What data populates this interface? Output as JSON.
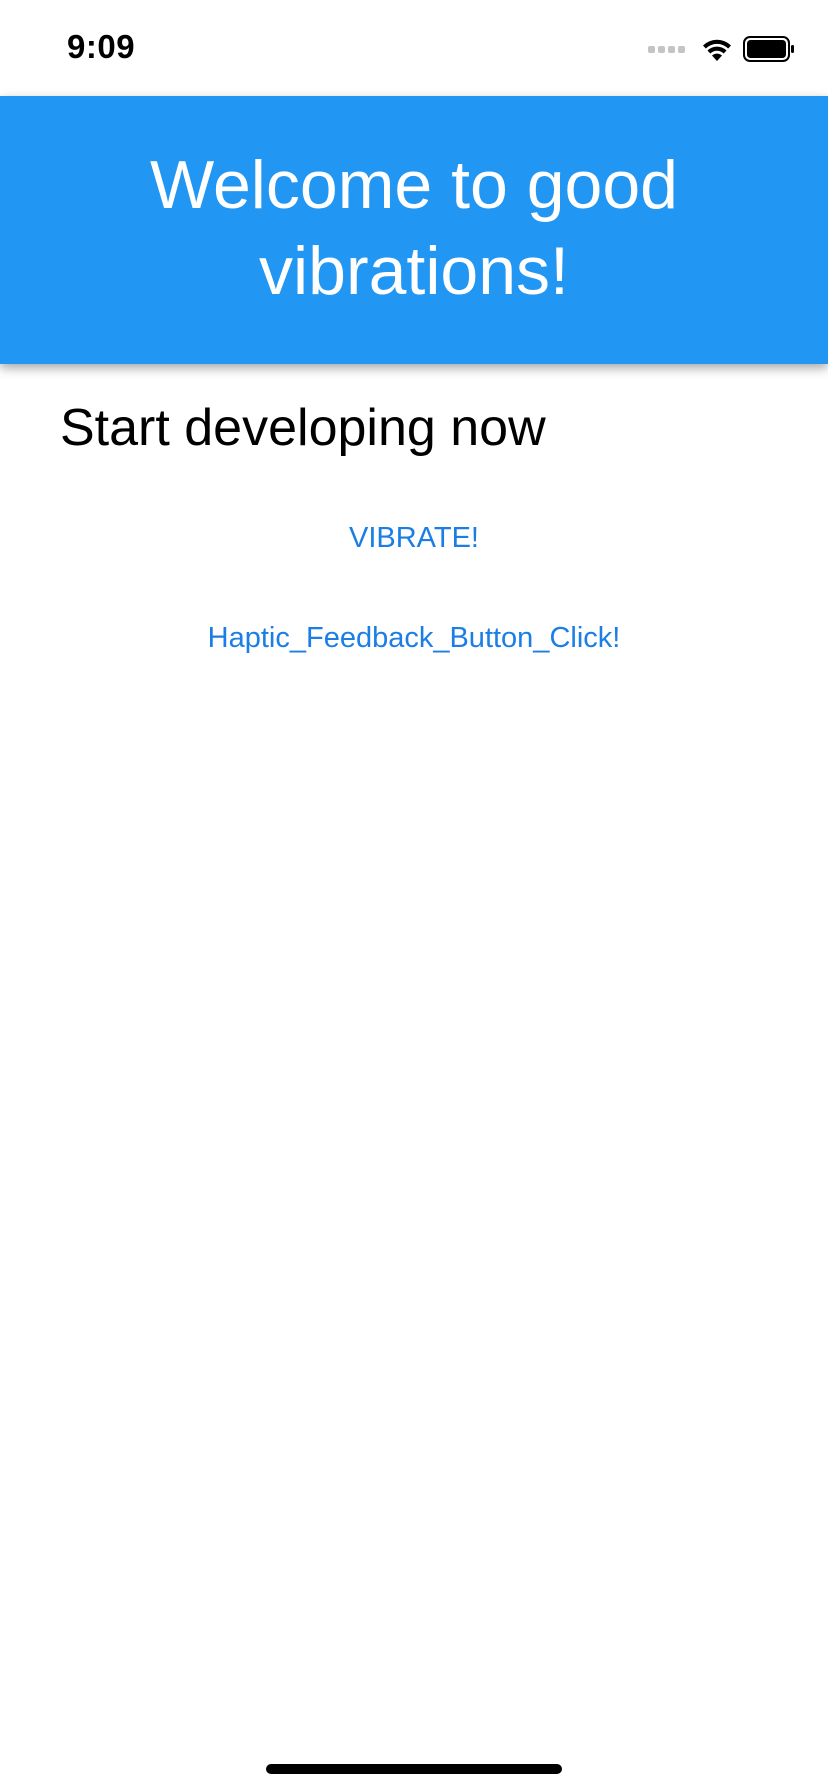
{
  "status_bar": {
    "time": "9:09",
    "icons": [
      "signal-dots-icon",
      "wifi-icon",
      "battery-icon"
    ]
  },
  "header": {
    "title": "Welcome to good vibrations!",
    "background_color": "#2196f3"
  },
  "main": {
    "subtitle": "Start developing now",
    "vibrate_label": "VIBRATE!",
    "haptic_label": "Haptic_Feedback_Button_Click!",
    "link_color": "#1a7ee6"
  }
}
